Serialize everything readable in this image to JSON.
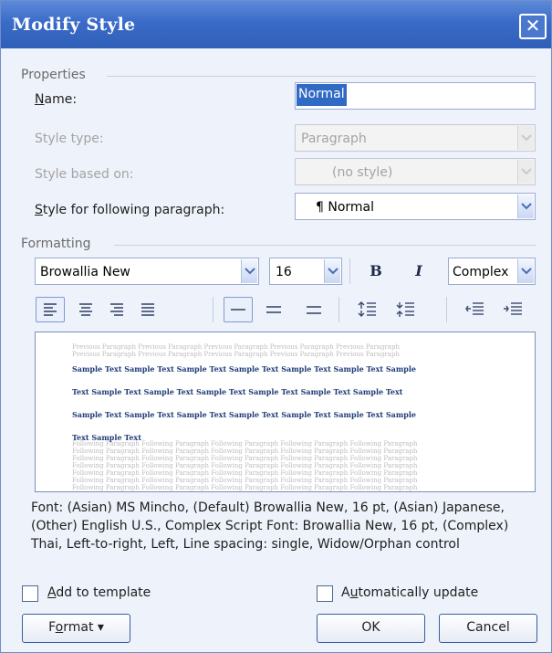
{
  "dialog": {
    "title": "Modify Style",
    "close_glyph": "✕"
  },
  "properties": {
    "section_label": "Properties",
    "name_label_prefix": "N",
    "name_label_rest": "ame:",
    "name_value": "Normal",
    "style_type_label": "Style type:",
    "style_type_value": "Paragraph",
    "style_based_on_label": "Style based on:",
    "style_based_on_value": "(no style)",
    "following_label_prefix": "S",
    "following_label_rest": "tyle for following paragraph:",
    "following_value": "¶ Normal"
  },
  "formatting": {
    "section_label": "Formatting",
    "font_value": "Browallia New",
    "size_value": "16",
    "bold_label": "B",
    "italic_label": "I",
    "script_value": "Complex"
  },
  "preview": {
    "previous_line": "Previous Paragraph Previous Paragraph Previous Paragraph Previous Paragraph Previous Paragraph",
    "sample_lines": [
      "Sample Text Sample Text Sample Text Sample Text Sample Text Sample Text Sample",
      "Text Sample Text Sample Text Sample Text Sample Text Sample Text Sample Text",
      "Sample Text Sample Text Sample Text Sample Text Sample Text Sample Text Sample",
      "Text Sample Text"
    ],
    "following_line": "Following Paragraph Following Paragraph Following Paragraph Following Paragraph Following Paragraph"
  },
  "description": "Font: (Asian) MS Mincho, (Default) Browallia New, 16 pt, (Asian) Japanese, (Other) English U.S., Complex Script Font: Browallia New, 16 pt, (Complex) Thai, Left-to-right, Left, Line spacing:  single, Widow/Orphan control",
  "options": {
    "add_to_template_prefix": "A",
    "add_to_template_rest": "dd to template",
    "auto_update_prefix": "A",
    "auto_update_u": "u",
    "auto_update_rest": "tomatically update"
  },
  "buttons": {
    "format_prefix": "F",
    "format_u": "o",
    "format_rest": "rmat",
    "format_arrow": "▾",
    "ok": "OK",
    "cancel": "Cancel"
  }
}
